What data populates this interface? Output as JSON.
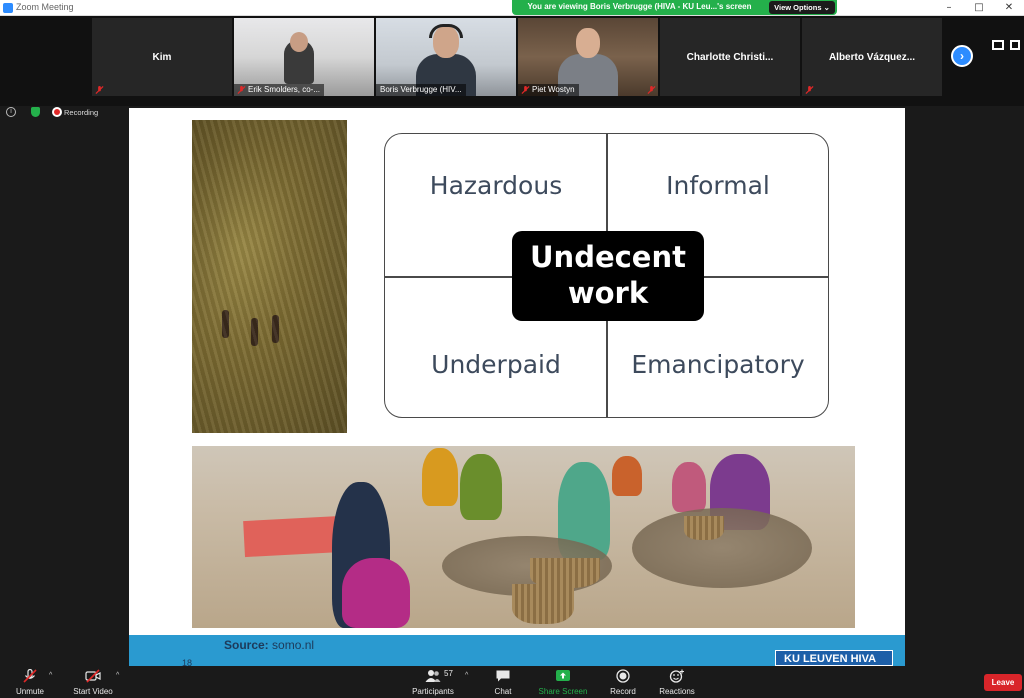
{
  "window": {
    "title": "Zoom Meeting"
  },
  "share_banner": {
    "message": "You are viewing Boris Verbrugge (HIVA - KU Leu...'s screen",
    "view_options": "View Options"
  },
  "participants": [
    {
      "name": "Kim",
      "type": "name-tile"
    },
    {
      "name": "Erik Smolders, co-...",
      "type": "video"
    },
    {
      "name": "Boris Verbrugge (HIV...",
      "type": "video"
    },
    {
      "name": "Piet Wostyn",
      "type": "video"
    },
    {
      "name": "Charlotte  Christi...",
      "type": "name-tile"
    },
    {
      "name": "Alberto  Vázquez...",
      "type": "name-tile"
    }
  ],
  "status": {
    "recording_label": "Recording"
  },
  "slide": {
    "quadrants": {
      "top_left": "Hazardous",
      "top_right": "Informal",
      "bottom_left": "Underpaid",
      "bottom_right": "Emancipatory"
    },
    "center_line1": "Undecent",
    "center_line2": "work",
    "source_label": "Source:",
    "source_value": "somo.nl",
    "page_number": "18",
    "logo_text": "KU LEUVEN  HIVA"
  },
  "toolbar": {
    "unmute": "Unmute",
    "start_video": "Start Video",
    "participants": "Participants",
    "participant_count": "57",
    "chat": "Chat",
    "share_screen": "Share Screen",
    "record": "Record",
    "reactions": "Reactions",
    "leave": "Leave"
  },
  "colors": {
    "share_green": "#24b04b",
    "leave_red": "#d9252a",
    "zoom_blue": "#2d8cff"
  }
}
